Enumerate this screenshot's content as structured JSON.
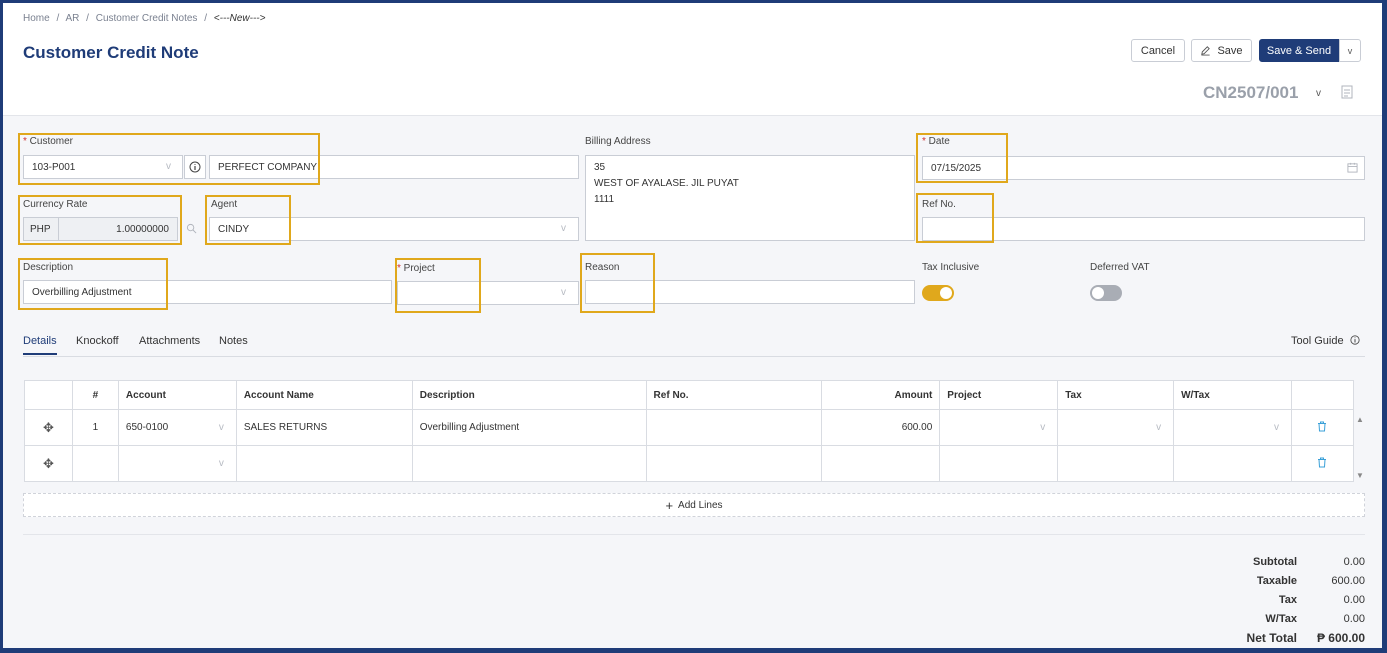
{
  "breadcrumb": {
    "items": [
      "Home",
      "/",
      "AR",
      "/",
      "Customer Credit Notes",
      "/"
    ],
    "current": "<---New--->"
  },
  "page_title": "Customer Credit Note",
  "actions": {
    "cancel_label": "Cancel",
    "save_label": "Save",
    "save_send_label": "Save & Send"
  },
  "doc_number": "CN2507/001",
  "form": {
    "customer_label": "Customer",
    "customer_code": "103-P001",
    "customer_name": "PERFECT COMPANY",
    "billing_address_label": "Billing Address",
    "billing_address_lines": [
      "35",
      "WEST OF AYALASE. JIL PUYAT",
      "1111"
    ],
    "date_label": "Date",
    "date_value": "07/15/2025",
    "currency_rate_label": "Currency Rate",
    "currency_code": "PHP",
    "currency_rate": "1.00000000",
    "agent_label": "Agent",
    "agent_value": "CINDY",
    "ref_no_label": "Ref No.",
    "ref_no_value": "",
    "description_label": "Description",
    "description_value": "Overbilling Adjustment",
    "project_label": "Project",
    "project_value": "",
    "reason_label": "Reason",
    "reason_value": "",
    "tax_inclusive_label": "Tax Inclusive",
    "tax_inclusive_on": true,
    "deferred_vat_label": "Deferred VAT",
    "deferred_vat_on": false
  },
  "tabs": [
    "Details",
    "Knockoff",
    "Attachments",
    "Notes"
  ],
  "active_tab": "Details",
  "tool_guide_label": "Tool Guide",
  "grid": {
    "columns": [
      "#",
      "Account",
      "Account Name",
      "Description",
      "Ref No.",
      "Amount",
      "Project",
      "Tax",
      "W/Tax"
    ],
    "rows": [
      {
        "no": "1",
        "account": "650-0100",
        "account_name": "SALES RETURNS",
        "description": "Overbilling Adjustment",
        "ref_no": "",
        "amount": "600.00",
        "project": "",
        "tax": "",
        "wtax": ""
      },
      {
        "no": "",
        "account": "",
        "account_name": "",
        "description": "",
        "ref_no": "",
        "amount": "",
        "project": "",
        "tax": "",
        "wtax": ""
      }
    ]
  },
  "add_lines_label": "Add Lines",
  "totals": {
    "subtotal_label": "Subtotal",
    "subtotal": "0.00",
    "taxable_label": "Taxable",
    "taxable": "600.00",
    "tax_label": "Tax",
    "tax": "0.00",
    "wtax_label": "W/Tax",
    "wtax": "0.00",
    "net_total_label": "Net Total",
    "net_total": "₱ 600.00"
  },
  "colors": {
    "brand": "#1f3c78",
    "highlight": "#e0a81c",
    "toggle_on": "#e0a81c",
    "toggle_off": "#a9adb5",
    "delete_icon": "#3aa0d8"
  }
}
